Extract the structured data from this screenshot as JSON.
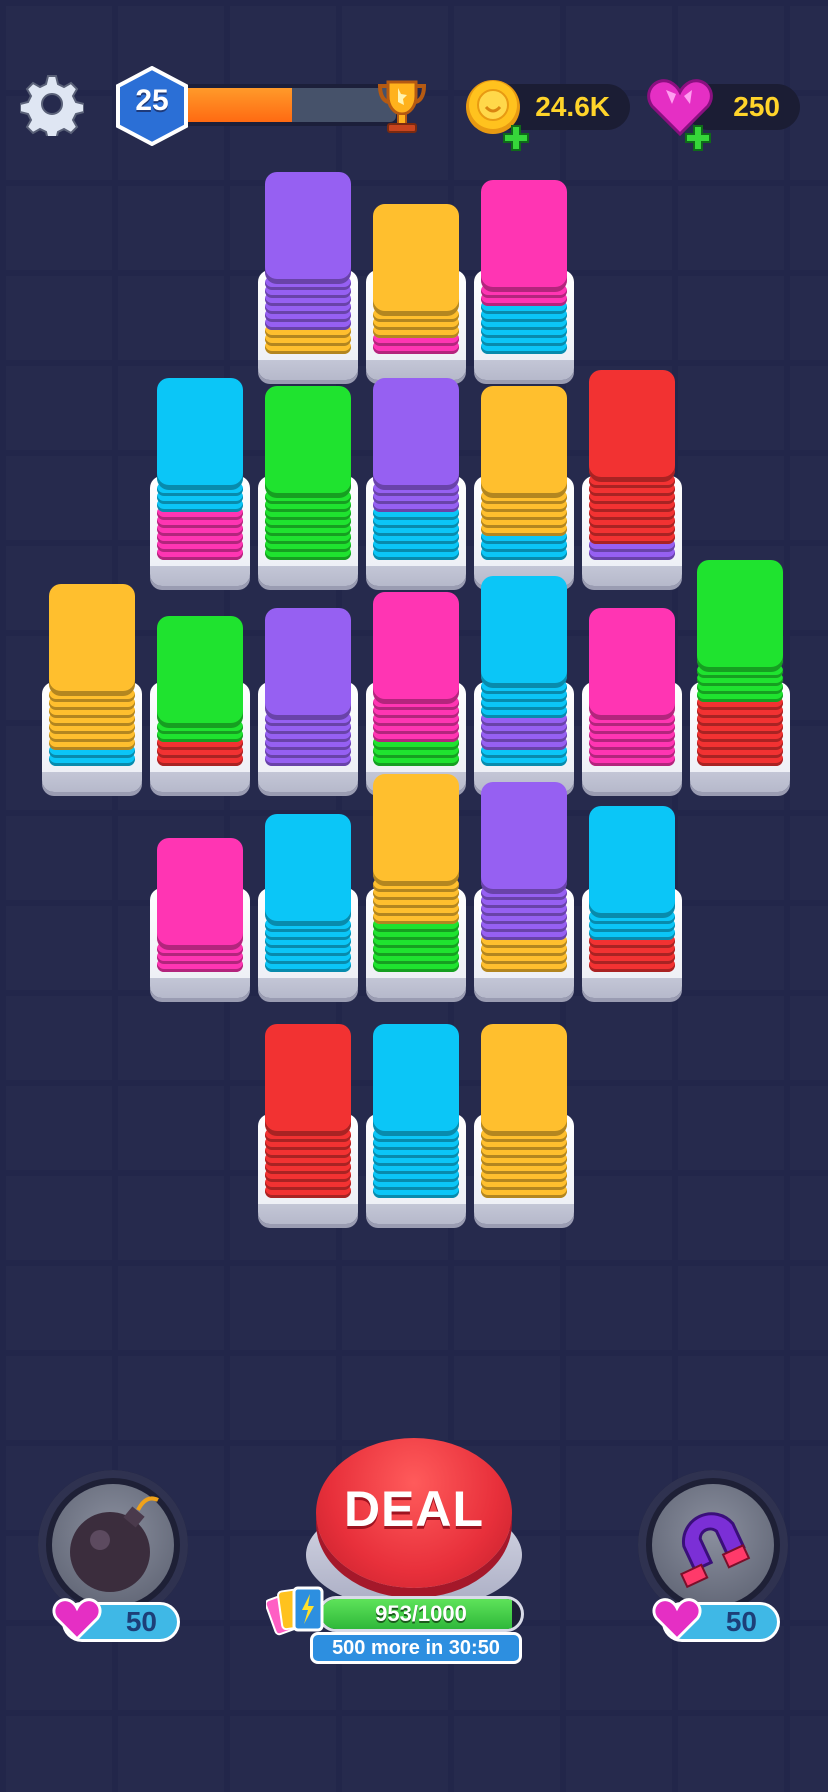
{
  "top_bar": {
    "settings_icon": "gear-icon",
    "level": {
      "number": "25",
      "progress": 0.55,
      "reward_icon": "trophy-icon"
    },
    "coins": {
      "value": "24.6K",
      "icon": "coin-icon",
      "add_icon": "plus-icon"
    },
    "gems": {
      "value": "250",
      "icon": "gem-heart-icon",
      "add_icon": "plus-icon"
    }
  },
  "colors": {
    "purple": "#9660f2",
    "yellow": "#ffbf2e",
    "pink": "#ff35b3",
    "blue": "#0bc6f7",
    "green": "#1fe32f",
    "red": "#f23232",
    "accent_orange": "#ff7a1c",
    "deal_red": "#e8303b"
  },
  "board": {
    "stacks": [
      {
        "layers": [
          "yellow",
          "yellow",
          "yellow",
          "purple",
          "purple",
          "purple",
          "purple",
          "purple",
          "purple"
        ],
        "top": "purple"
      },
      {
        "layers": [
          "pink",
          "pink",
          "yellow",
          "yellow",
          "yellow"
        ],
        "top": "yellow"
      },
      {
        "layers": [
          "blue",
          "blue",
          "blue",
          "blue",
          "blue",
          "blue",
          "pink",
          "pink"
        ],
        "top": "pink"
      },
      {
        "layers": [
          "pink",
          "pink",
          "pink",
          "pink",
          "pink",
          "pink",
          "blue",
          "blue",
          "blue"
        ],
        "top": "blue"
      },
      {
        "layers": [
          "green",
          "green",
          "green",
          "green",
          "green",
          "green",
          "green",
          "green"
        ],
        "top": "green"
      },
      {
        "layers": [
          "blue",
          "blue",
          "blue",
          "blue",
          "blue",
          "blue",
          "purple",
          "purple",
          "purple"
        ],
        "top": "purple"
      },
      {
        "layers": [
          "blue",
          "blue",
          "blue",
          "yellow",
          "yellow",
          "yellow",
          "yellow",
          "yellow"
        ],
        "top": "yellow"
      },
      {
        "layers": [
          "purple",
          "purple",
          "red",
          "red",
          "red",
          "red",
          "red",
          "red",
          "red",
          "red"
        ],
        "top": "red"
      },
      {
        "layers": [
          "blue",
          "blue",
          "yellow",
          "yellow",
          "yellow",
          "yellow",
          "yellow",
          "yellow",
          "yellow"
        ],
        "top": "yellow"
      },
      {
        "layers": [
          "red",
          "red",
          "red",
          "green",
          "green"
        ],
        "top": "green"
      },
      {
        "layers": [
          "purple",
          "purple",
          "purple",
          "purple",
          "purple",
          "purple"
        ],
        "top": "purple"
      },
      {
        "layers": [
          "green",
          "green",
          "green",
          "pink",
          "pink",
          "pink",
          "pink",
          "pink"
        ],
        "top": "pink"
      },
      {
        "layers": [
          "blue",
          "blue",
          "purple",
          "purple",
          "purple",
          "purple",
          "blue",
          "blue",
          "blue",
          "blue"
        ],
        "top": "blue"
      },
      {
        "layers": [
          "pink",
          "pink",
          "pink",
          "pink",
          "pink",
          "pink"
        ],
        "top": "pink"
      },
      {
        "layers": [
          "red",
          "red",
          "red",
          "red",
          "red",
          "red",
          "red",
          "red",
          "green",
          "green",
          "green",
          "green"
        ],
        "top": "green"
      },
      {
        "layers": [
          "pink",
          "pink",
          "pink"
        ],
        "top": "pink"
      },
      {
        "layers": [
          "blue",
          "blue",
          "blue",
          "blue",
          "blue",
          "blue"
        ],
        "top": "blue"
      },
      {
        "layers": [
          "green",
          "green",
          "green",
          "green",
          "green",
          "green",
          "yellow",
          "yellow",
          "yellow",
          "yellow",
          "yellow"
        ],
        "top": "yellow"
      },
      {
        "layers": [
          "yellow",
          "yellow",
          "yellow",
          "yellow",
          "purple",
          "purple",
          "purple",
          "purple",
          "purple",
          "purple"
        ],
        "top": "purple"
      },
      {
        "layers": [
          "red",
          "red",
          "red",
          "red",
          "blue",
          "blue",
          "blue"
        ],
        "top": "blue"
      },
      {
        "layers": [
          "red",
          "red",
          "red",
          "red",
          "red",
          "red",
          "red",
          "red"
        ],
        "top": "red"
      },
      {
        "layers": [
          "blue",
          "blue",
          "blue",
          "blue",
          "blue",
          "blue",
          "blue",
          "blue"
        ],
        "top": "blue"
      },
      {
        "layers": [
          "yellow",
          "yellow",
          "yellow",
          "yellow",
          "yellow",
          "yellow",
          "yellow",
          "yellow"
        ],
        "top": "yellow"
      }
    ]
  },
  "bottom": {
    "bomb": {
      "icon": "bomb-icon",
      "cost": "50",
      "cost_icon": "gem-heart-icon"
    },
    "deal": {
      "label": "DEAL",
      "progress_text": "953/1000",
      "progress": 0.953,
      "timer_text": "500 more in 30:50",
      "cards_icon": "lightning-cards-icon"
    },
    "magnet": {
      "icon": "magnet-icon",
      "cost": "50",
      "cost_icon": "gem-heart-icon"
    }
  }
}
